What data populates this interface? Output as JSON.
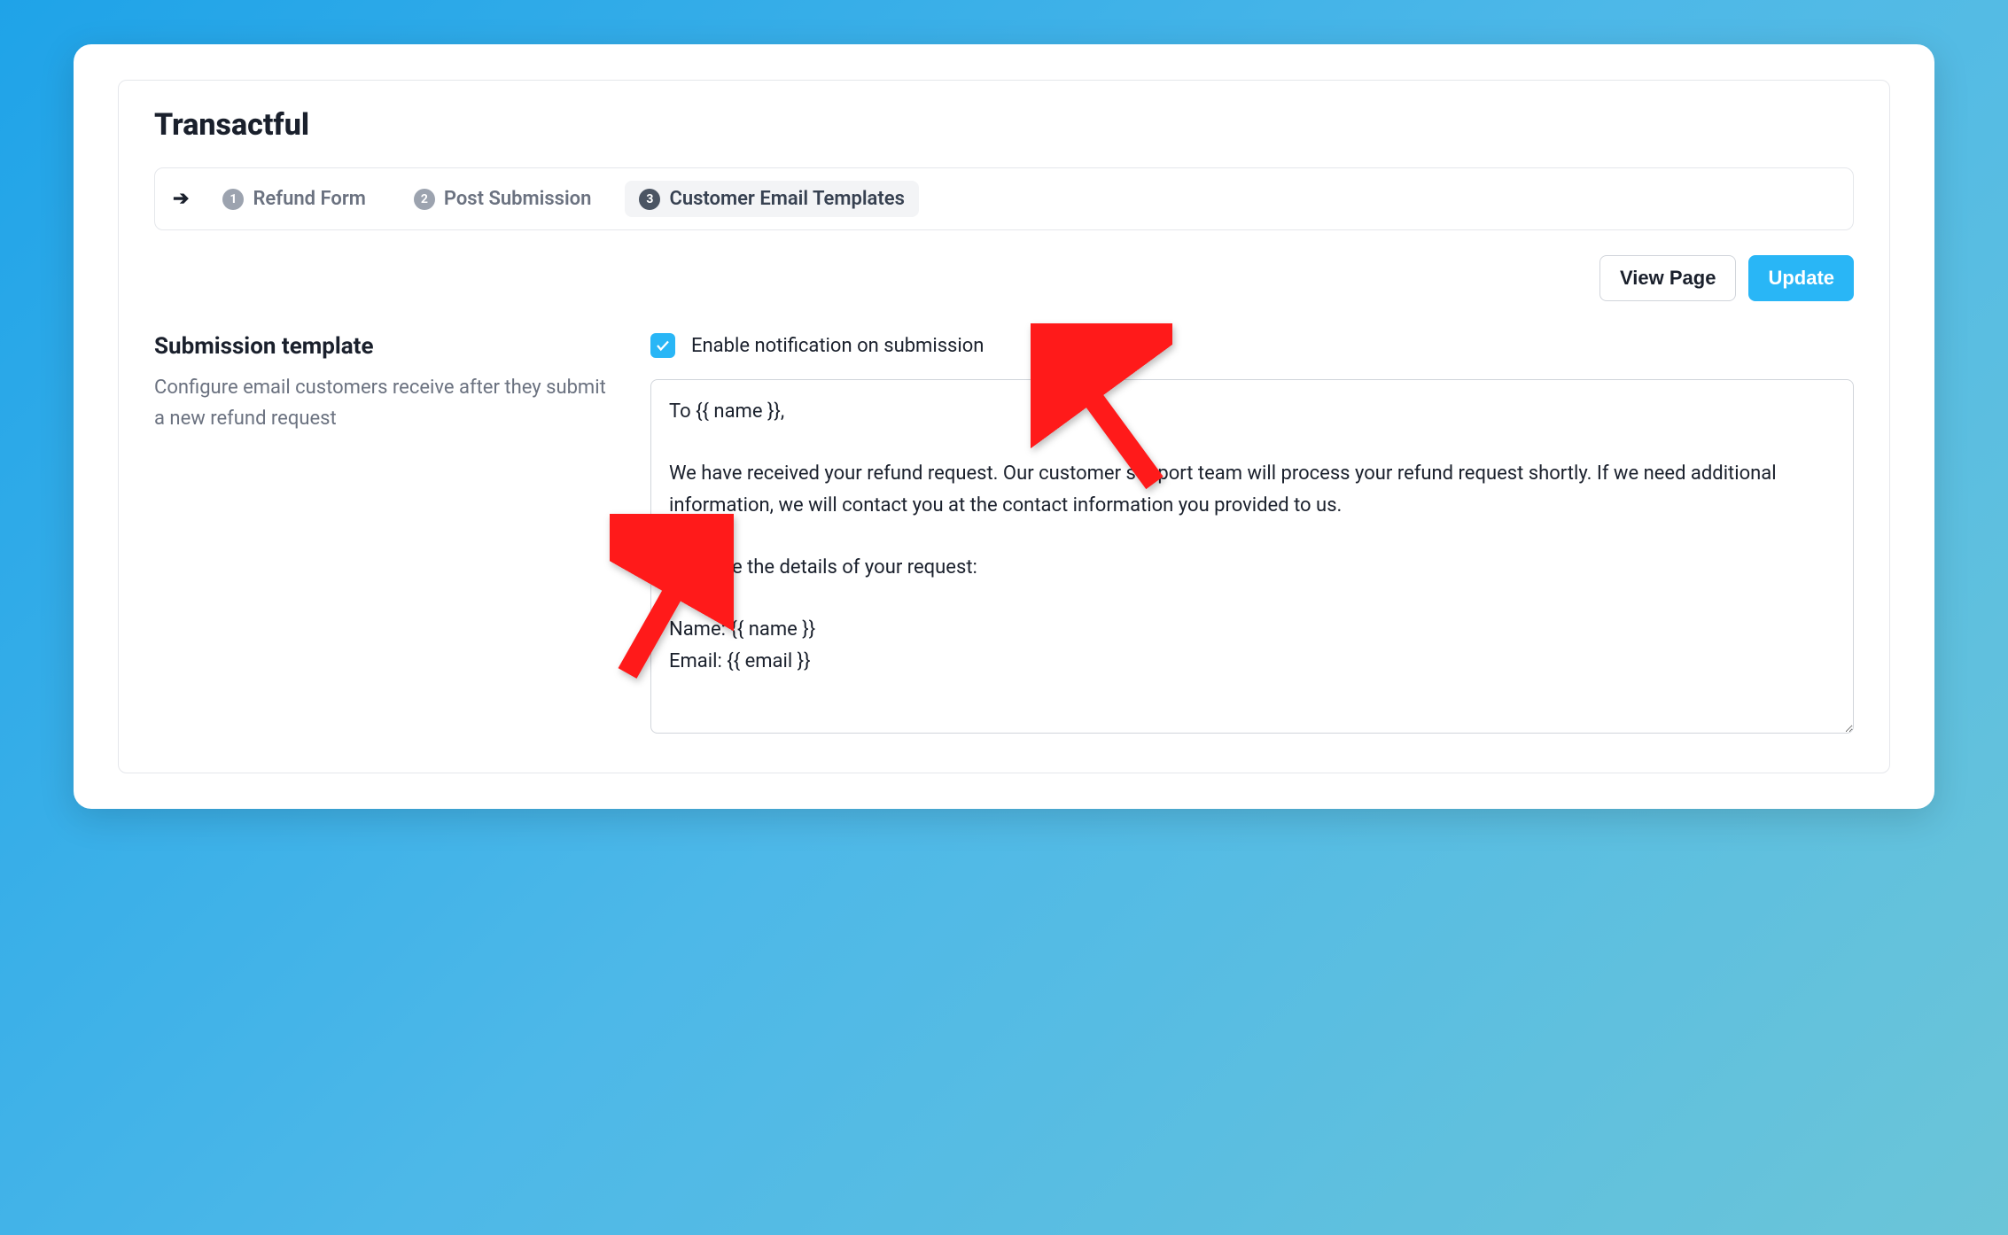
{
  "header": {
    "title": "Transactful"
  },
  "tabs": {
    "items": [
      {
        "number": "1",
        "label": "Refund Form"
      },
      {
        "number": "2",
        "label": "Post Submission"
      },
      {
        "number": "3",
        "label": "Customer Email Templates"
      }
    ]
  },
  "actions": {
    "view_page": "View Page",
    "update": "Update"
  },
  "section": {
    "title": "Submission template",
    "description": "Configure email customers receive after they submit a new refund request"
  },
  "checkbox": {
    "label": "Enable notification on submission",
    "checked": true
  },
  "template": {
    "body": "To {{ name }},\n\nWe have received your refund request. Our customer support team will process your refund request shortly. If we need additional information, we will contact you at the contact information you provided to us.\n\nHere are the details of your request:\n\nName: {{ name }}\nEmail: {{ email }}"
  }
}
